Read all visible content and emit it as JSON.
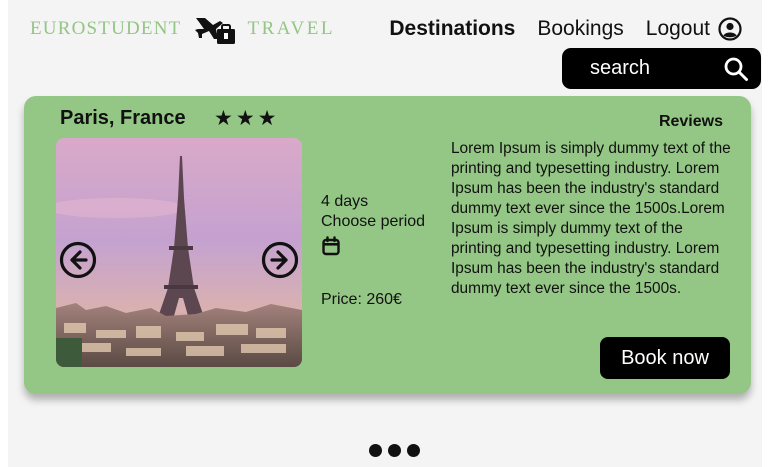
{
  "header": {
    "logo_word_1": "EUROSTUDENT",
    "logo_word_2": "TRAVEL",
    "logo_icon": "plane-luggage-icon"
  },
  "nav": {
    "items": [
      "Destinations",
      "Bookings",
      "Logout"
    ],
    "active": "Destinations",
    "user_icon": "user-circle-icon"
  },
  "search": {
    "placeholder": "search",
    "icon": "search-icon"
  },
  "card": {
    "destination": "Paris, France",
    "stars": "★★★",
    "rating": 3,
    "duration": "4 days",
    "choose_period": "Choose period",
    "calendar_icon": "calendar-icon",
    "price": "Price: 260€",
    "reviews_heading": "Reviews",
    "review_text": "Lorem Ipsum is simply dummy text of the printing and typesetting industry. Lorem Ipsum has been the industry's standard dummy text ever since the 1500s.Lorem Ipsum is simply dummy text of the printing and typesetting industry. Lorem Ipsum has been the industry's standard dummy text ever since the 1500s.",
    "book_label": "Book now",
    "prev_icon": "arrow-left-circle-icon",
    "next_icon": "arrow-right-circle-icon"
  },
  "pagination": {
    "dots": 3
  },
  "colors": {
    "card_bg": "#94c785",
    "logo": "#93c585",
    "button_bg": "#000000",
    "button_text": "#ffffff"
  }
}
